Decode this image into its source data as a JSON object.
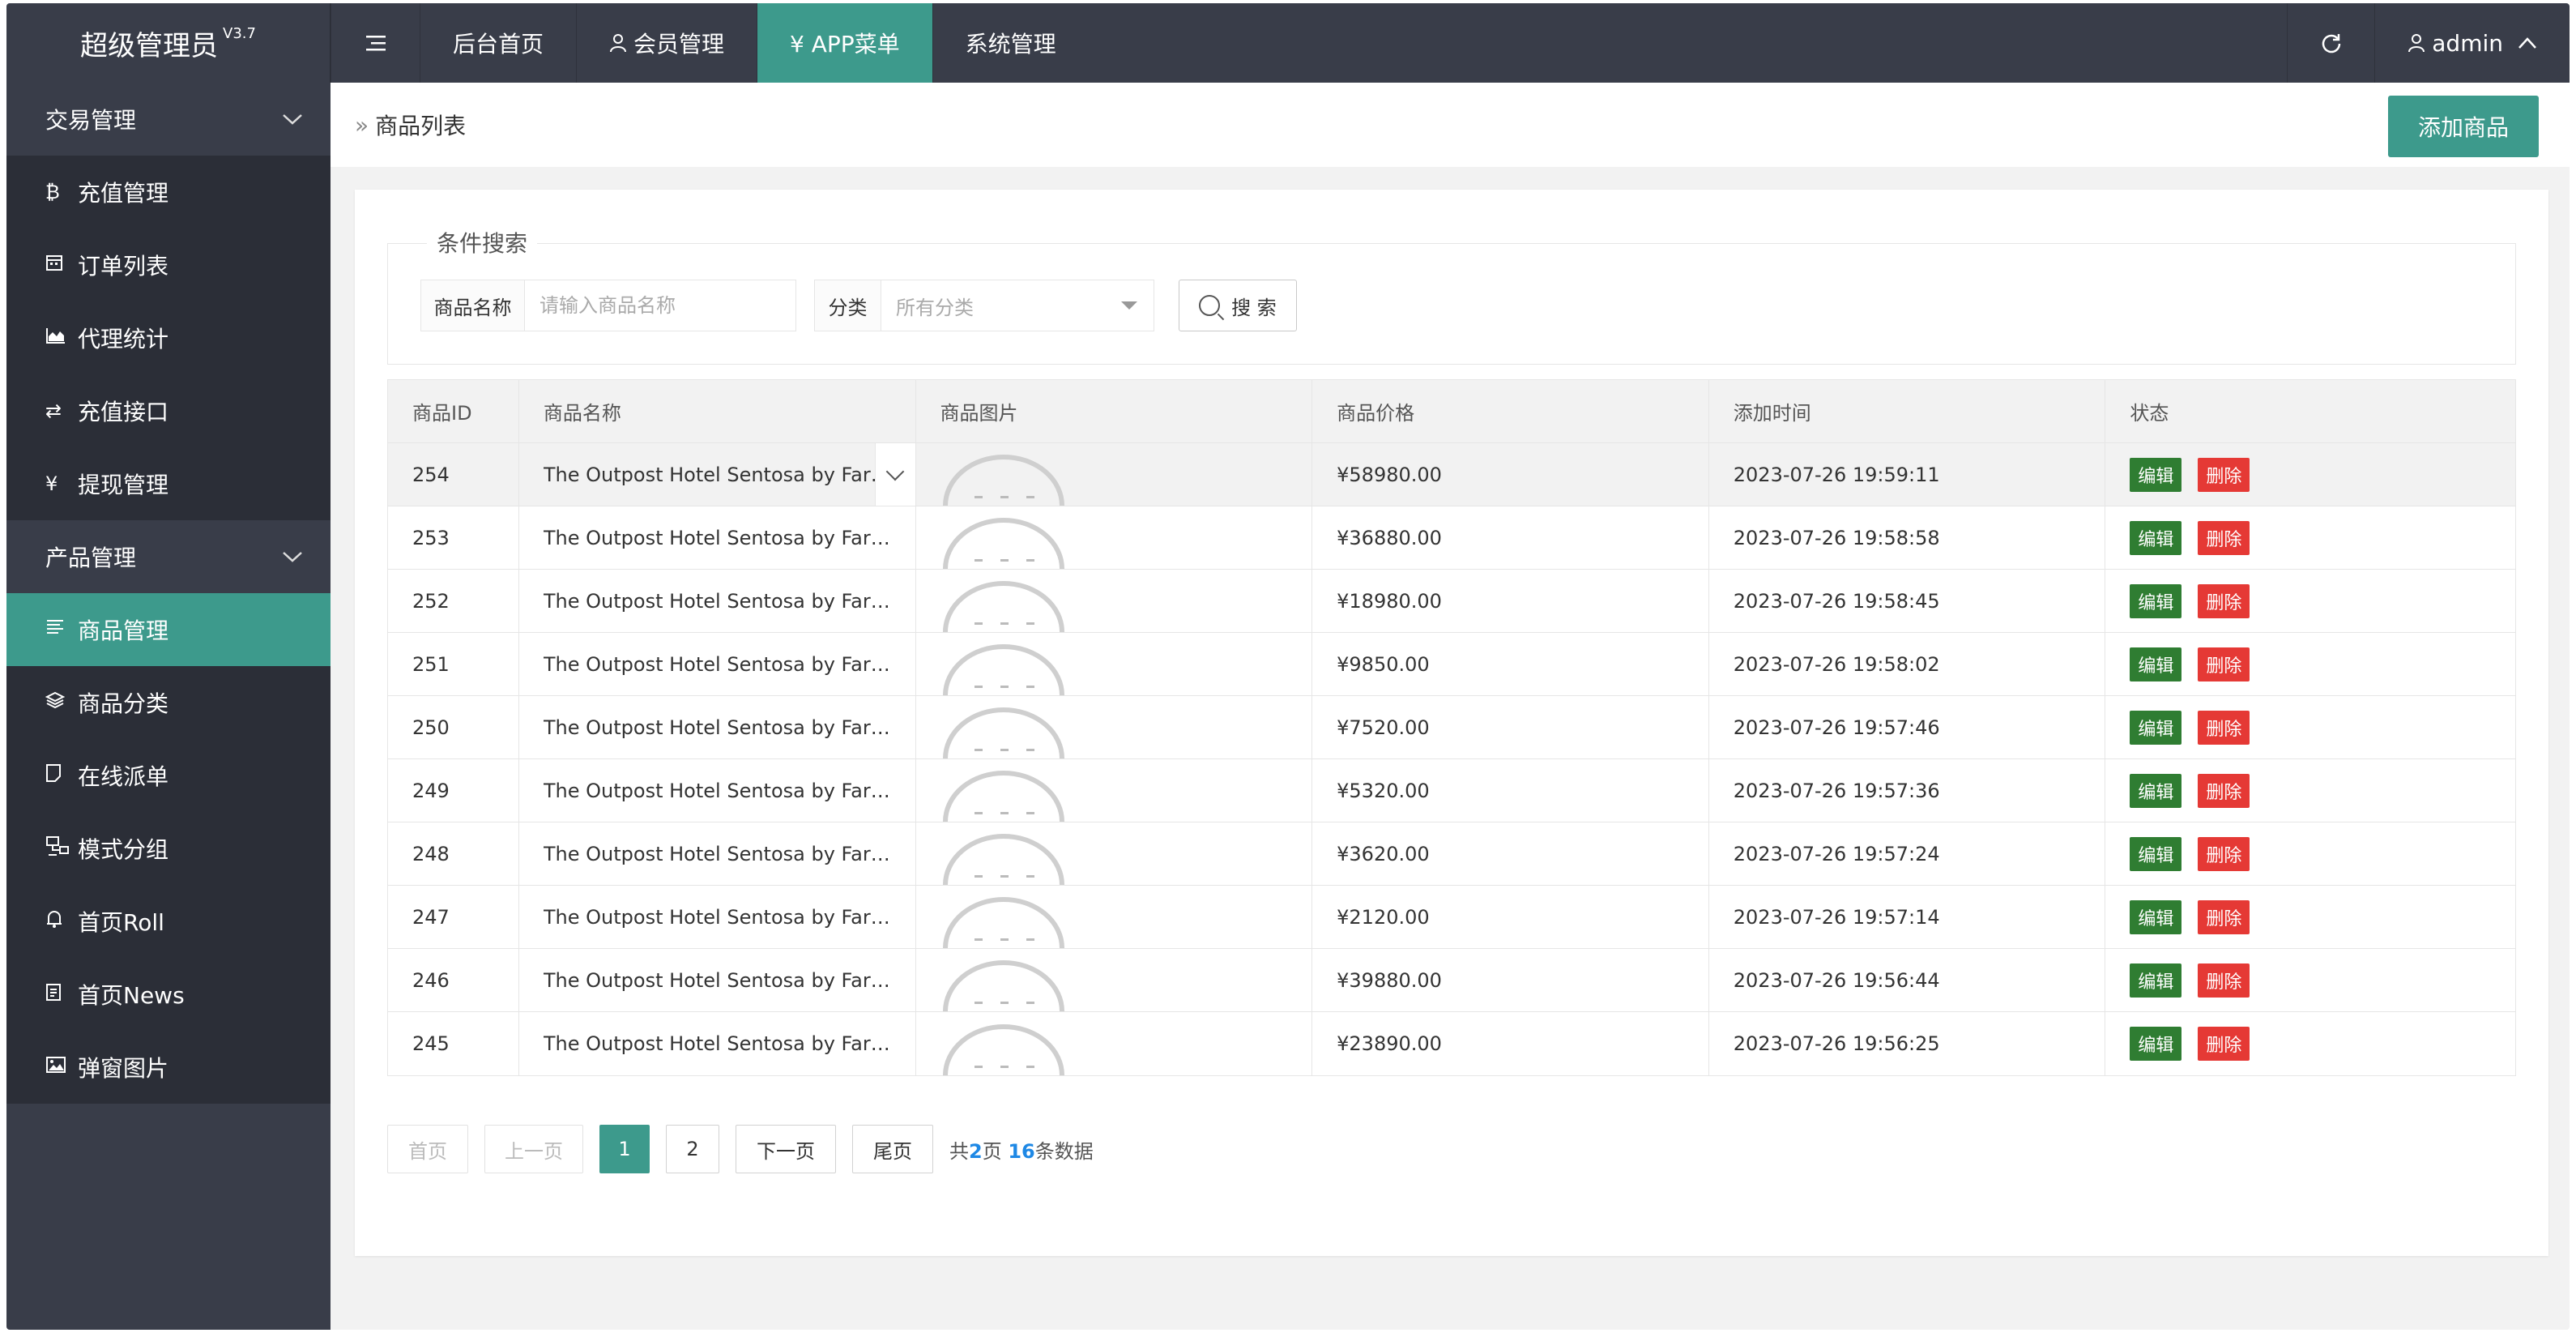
{
  "header": {
    "app_title": "超级管理员",
    "version": "V3.7",
    "nav": [
      {
        "label": "后台首页"
      },
      {
        "label": "会员管理"
      },
      {
        "label": "¥ APP菜单"
      },
      {
        "label": "系统管理"
      }
    ],
    "user": "admin"
  },
  "sidebar": {
    "groups": [
      {
        "label": "交易管理"
      },
      {
        "label": "产品管理"
      }
    ],
    "items": [
      {
        "label": "充值管理",
        "icon": "bitcoin-icon"
      },
      {
        "label": "订单列表",
        "icon": "calendar-icon"
      },
      {
        "label": "代理统计",
        "icon": "area-chart-icon"
      },
      {
        "label": "充值接口",
        "icon": "exchange-icon"
      },
      {
        "label": "提现管理",
        "icon": "yen-icon"
      },
      {
        "label": "商品管理",
        "icon": "list-icon"
      },
      {
        "label": "商品分类",
        "icon": "layers-icon"
      },
      {
        "label": "在线派单",
        "icon": "note-icon"
      },
      {
        "label": "模式分组",
        "icon": "sitemap-icon"
      },
      {
        "label": "首页Roll",
        "icon": "bell-icon"
      },
      {
        "label": "首页News",
        "icon": "news-icon"
      },
      {
        "label": "弹窗图片",
        "icon": "image-icon"
      }
    ]
  },
  "page": {
    "breadcrumb": "商品列表",
    "add_button": "添加商品"
  },
  "search": {
    "legend": "条件搜索",
    "name_label": "商品名称",
    "name_placeholder": "请输入商品名称",
    "category_label": "分类",
    "category_value": "所有分类",
    "search_button": "搜 索"
  },
  "table": {
    "columns": [
      "商品ID",
      "商品名称",
      "商品图片",
      "商品价格",
      "添加时间",
      "状态"
    ],
    "edit_label": "编辑",
    "delete_label": "删除",
    "rows": [
      {
        "id": "254",
        "name": "The Outpost Hotel Sentosa by Far East Hospitality",
        "price": "¥58980.00",
        "time": "2023-07-26 19:59:11"
      },
      {
        "id": "253",
        "name": "The Outpost Hotel Sentosa by Far East Hospitality",
        "price": "¥36880.00",
        "time": "2023-07-26 19:58:58"
      },
      {
        "id": "252",
        "name": "The Outpost Hotel Sentosa by Far East Hospitality",
        "price": "¥18980.00",
        "time": "2023-07-26 19:58:45"
      },
      {
        "id": "251",
        "name": "The Outpost Hotel Sentosa by Far East Hospitality",
        "price": "¥9850.00",
        "time": "2023-07-26 19:58:02"
      },
      {
        "id": "250",
        "name": "The Outpost Hotel Sentosa by Far East Hospitality",
        "price": "¥7520.00",
        "time": "2023-07-26 19:57:46"
      },
      {
        "id": "249",
        "name": "The Outpost Hotel Sentosa by Far East Hospitality",
        "price": "¥5320.00",
        "time": "2023-07-26 19:57:36"
      },
      {
        "id": "248",
        "name": "The Outpost Hotel Sentosa by Far East Hospitality",
        "price": "¥3620.00",
        "time": "2023-07-26 19:57:24"
      },
      {
        "id": "247",
        "name": "The Outpost Hotel Sentosa by Far East Hospitality",
        "price": "¥2120.00",
        "time": "2023-07-26 19:57:14"
      },
      {
        "id": "246",
        "name": "The Outpost Hotel Sentosa by Far East Hospitality",
        "price": "¥39880.00",
        "time": "2023-07-26 19:56:44"
      },
      {
        "id": "245",
        "name": "The Outpost Hotel Sentosa by Far East Hospitality",
        "price": "¥23890.00",
        "time": "2023-07-26 19:56:25"
      }
    ]
  },
  "pagination": {
    "first": "首页",
    "prev": "上一页",
    "pages": [
      "1",
      "2"
    ],
    "current": "1",
    "next": "下一页",
    "last": "尾页",
    "info_prefix": "共",
    "total_pages": "2",
    "info_mid": "页",
    "total_items": "16",
    "info_suffix": "条数据"
  },
  "colors": {
    "header_bg": "#393d49",
    "accent": "#3d9a8c",
    "edit": "#2f7d32",
    "delete": "#e53935"
  }
}
